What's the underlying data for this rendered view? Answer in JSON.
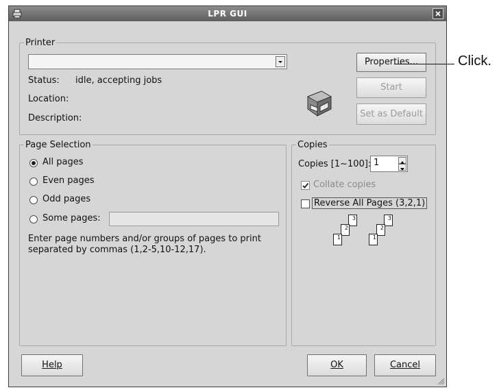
{
  "window": {
    "title": "LPR GUI"
  },
  "printer": {
    "legend": "Printer",
    "selected": "",
    "status_label": "Status:",
    "status_value": "idle, accepting jobs",
    "location_label": "Location:",
    "location_value": "",
    "description_label": "Description:",
    "description_value": "",
    "properties_label": "Properties...",
    "start_label": "Start",
    "set_default_label": "Set as Default"
  },
  "page_selection": {
    "legend": "Page Selection",
    "options": [
      {
        "label": "All pages",
        "selected": true
      },
      {
        "label": "Even pages",
        "selected": false
      },
      {
        "label": "Odd pages",
        "selected": false
      },
      {
        "label": "Some pages:",
        "selected": false
      }
    ],
    "some_pages_value": "",
    "hint_line1": "Enter page numbers and/or groups of pages to print",
    "hint_line2": "separated by commas (1,2-5,10-12,17)."
  },
  "copies": {
    "legend": "Copies",
    "count_label": "Copies [1~100]:",
    "count_value": "1",
    "collate_label": "Collate copies",
    "collate_checked": true,
    "reverse_label": "Reverse All Pages (3,2,1)",
    "reverse_checked": false,
    "page_numbers": [
      "1",
      "2",
      "3"
    ]
  },
  "footer": {
    "help_label": "Help",
    "ok_label": "OK",
    "cancel_label": "Cancel"
  },
  "annotation": {
    "text": "Click."
  }
}
